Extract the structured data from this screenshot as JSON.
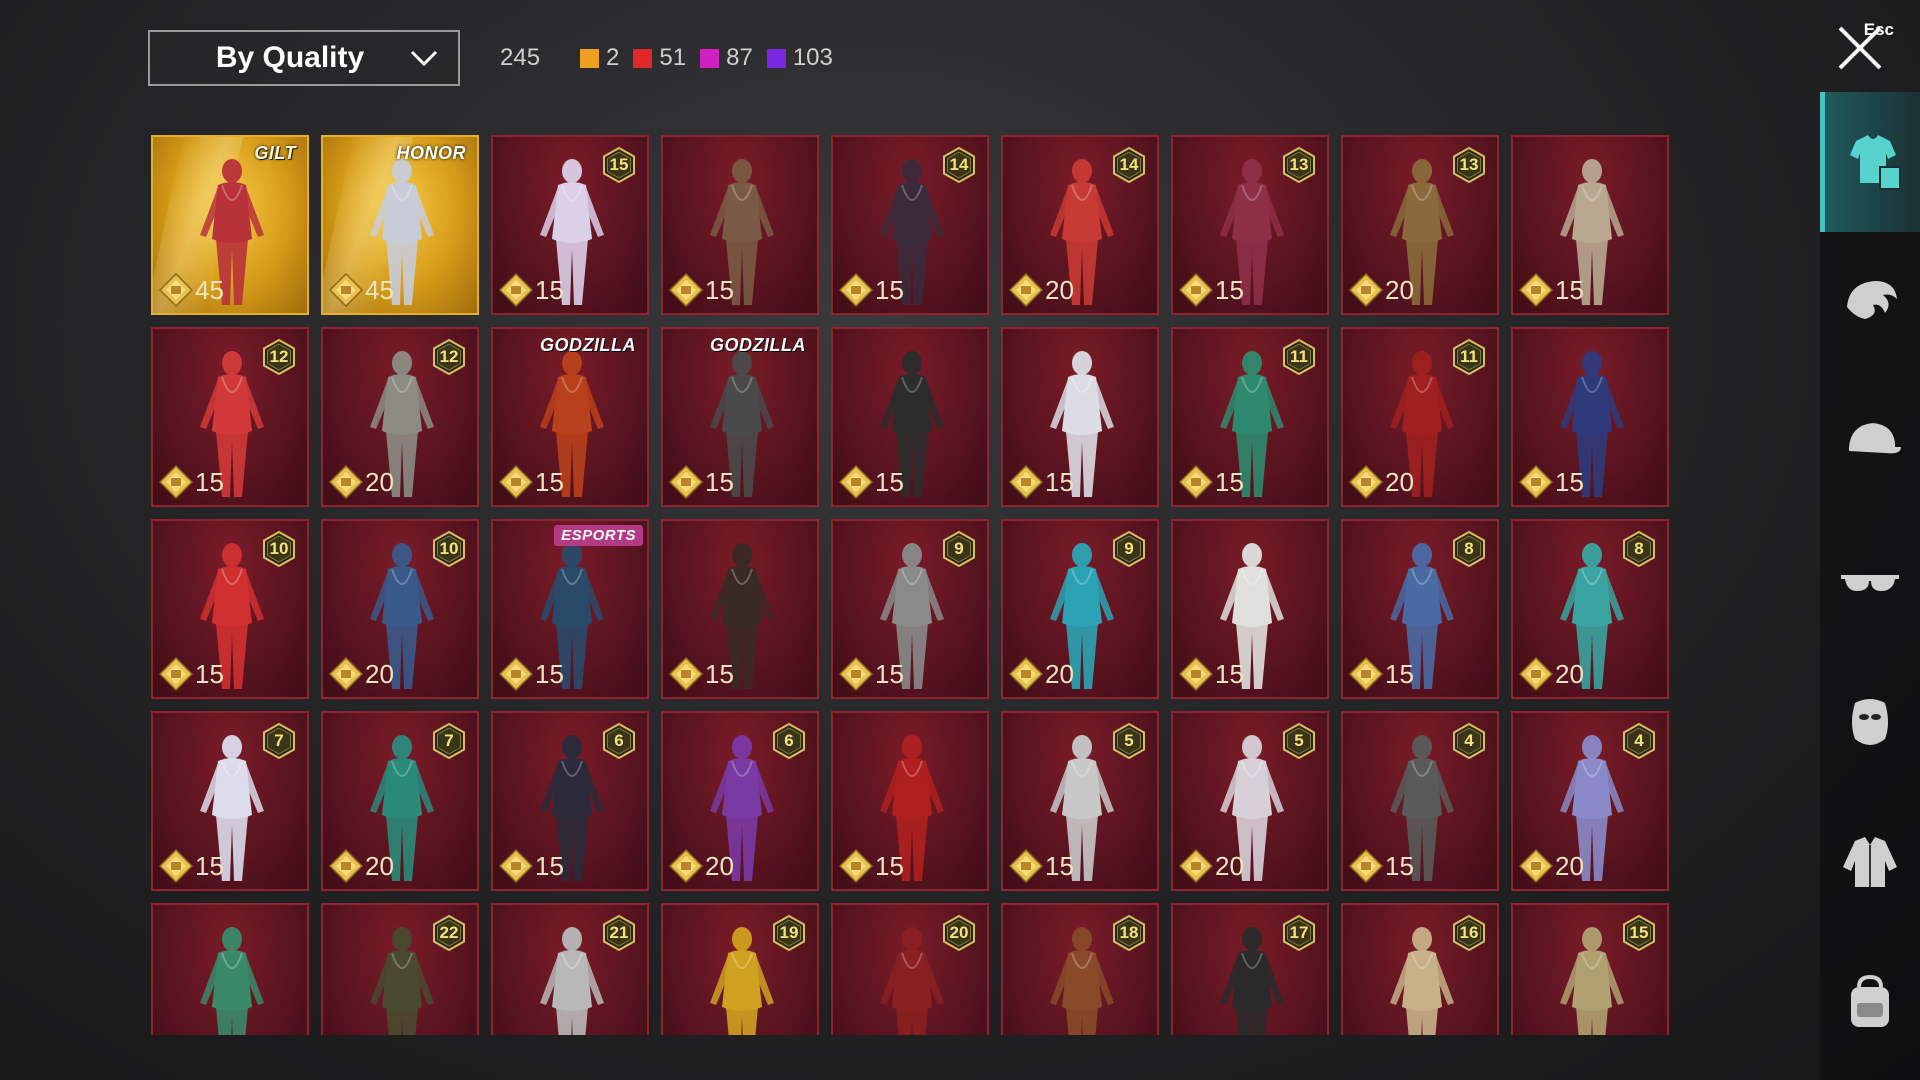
{
  "filter": {
    "label": "By Quality"
  },
  "counts": {
    "total": "245",
    "items": [
      {
        "color": "#f0a020",
        "value": "2"
      },
      {
        "color": "#e02828",
        "value": "51"
      },
      {
        "color": "#d020c0",
        "value": "87"
      },
      {
        "color": "#7a28e0",
        "value": "103"
      }
    ]
  },
  "close": {
    "label": "Esc",
    "icon": "close-icon"
  },
  "card_colors": {
    "gold_border": "#e2b02c",
    "red_border": "#8e2430"
  },
  "cards": [
    {
      "cost": "45",
      "gold": true,
      "logo": "GILT",
      "logo_style": "gilt",
      "figure": "#b8323a"
    },
    {
      "cost": "45",
      "gold": true,
      "logo": "HONOR",
      "logo_style": "honor",
      "figure": "#c8ccd8"
    },
    {
      "cost": "15",
      "badge": "15",
      "figure": "#dccfe8"
    },
    {
      "cost": "15",
      "figure": "#7a5a44"
    },
    {
      "cost": "15",
      "badge": "14",
      "figure": "#3a2a3c"
    },
    {
      "cost": "20",
      "badge": "14",
      "figure": "#c83a34"
    },
    {
      "cost": "15",
      "badge": "13",
      "figure": "#8e3048"
    },
    {
      "cost": "20",
      "badge": "13",
      "figure": "#8a6a3a"
    },
    {
      "cost": "15",
      "figure": "#b8a890"
    },
    {
      "cost": "15",
      "badge": "12",
      "figure": "#d23a3a"
    },
    {
      "cost": "20",
      "badge": "12",
      "figure": "#8c8c84"
    },
    {
      "cost": "15",
      "logo": "GODZILLA",
      "logo_style": "godzilla",
      "figure": "#b8401c"
    },
    {
      "cost": "15",
      "logo": "GODZILLA",
      "logo_style": "godzilla",
      "figure": "#4a4a4a"
    },
    {
      "cost": "15",
      "figure": "#2c2c2c"
    },
    {
      "cost": "15",
      "figure": "#dcdce4"
    },
    {
      "cost": "15",
      "badge": "11",
      "figure": "#2e8a6e"
    },
    {
      "cost": "20",
      "badge": "11",
      "figure": "#a02020"
    },
    {
      "cost": "15",
      "figure": "#2e3a7a"
    },
    {
      "cost": "15",
      "badge": "10",
      "figure": "#d03030"
    },
    {
      "cost": "20",
      "badge": "10",
      "figure": "#3a5a8a"
    },
    {
      "cost": "15",
      "logo": "ESPORTS",
      "logo_style": "esports",
      "figure": "#2a4a6a"
    },
    {
      "cost": "15",
      "figure": "#3a2a24"
    },
    {
      "cost": "15",
      "badge": "9",
      "figure": "#8a8a8a"
    },
    {
      "cost": "20",
      "badge": "9",
      "figure": "#2aa4b4"
    },
    {
      "cost": "15",
      "figure": "#e0e0dc"
    },
    {
      "cost": "15",
      "badge": "8",
      "figure": "#4a6aa4"
    },
    {
      "cost": "20",
      "badge": "8",
      "figure": "#3aa4a0"
    },
    {
      "cost": "15",
      "badge": "7",
      "figure": "#dcdcec"
    },
    {
      "cost": "20",
      "badge": "7",
      "figure": "#2a8a7a"
    },
    {
      "cost": "15",
      "badge": "6",
      "figure": "#2a2a3a"
    },
    {
      "cost": "20",
      "badge": "6",
      "figure": "#7a3aa4"
    },
    {
      "cost": "15",
      "figure": "#b02020"
    },
    {
      "cost": "15",
      "badge": "5",
      "figure": "#c8c8c8"
    },
    {
      "cost": "20",
      "badge": "5",
      "figure": "#d8d0d8"
    },
    {
      "cost": "15",
      "badge": "4",
      "figure": "#5a5a5a"
    },
    {
      "cost": "20",
      "badge": "4",
      "figure": "#8a8ac8"
    },
    {
      "figure": "#3a8a6a"
    },
    {
      "badge": "22",
      "figure": "#4a4a30"
    },
    {
      "badge": "21",
      "figure": "#b8b8b8"
    },
    {
      "badge": "19",
      "figure": "#d0a020"
    },
    {
      "badge": "20",
      "figure": "#8a2020"
    },
    {
      "badge": "18",
      "figure": "#8a4a2a"
    },
    {
      "badge": "17",
      "figure": "#2a2a2a"
    },
    {
      "badge": "16",
      "figure": "#c8b088"
    },
    {
      "badge": "15",
      "figure": "#b0a070"
    }
  ],
  "sidebar": [
    {
      "icon": "outfit-icon",
      "active": true
    },
    {
      "icon": "hair-icon"
    },
    {
      "icon": "cap-icon"
    },
    {
      "icon": "glasses-icon"
    },
    {
      "icon": "mask-icon"
    },
    {
      "icon": "jacket-icon"
    },
    {
      "icon": "bag-icon"
    }
  ]
}
